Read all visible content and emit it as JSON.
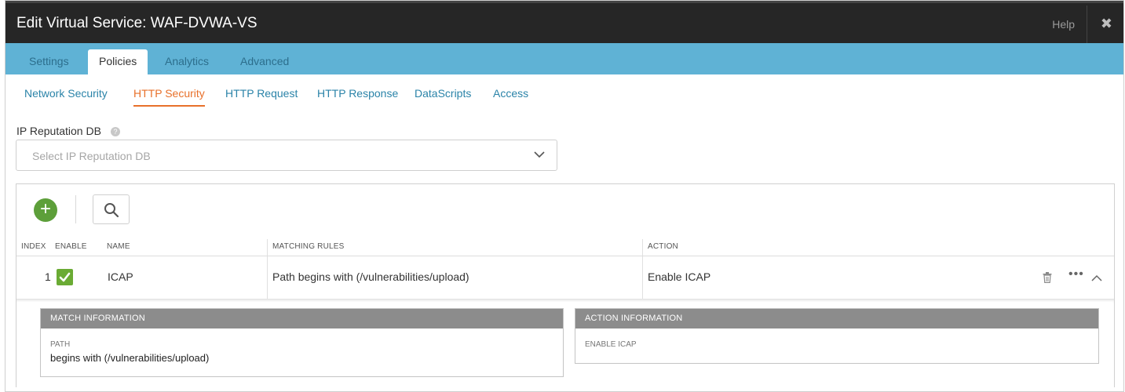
{
  "window": {
    "title": "Edit Virtual Service: WAF-DVWA-VS",
    "help_label": "Help",
    "close_glyph": "✖"
  },
  "tabs": [
    {
      "label": "Settings",
      "active": false
    },
    {
      "label": "Policies",
      "active": true
    },
    {
      "label": "Analytics",
      "active": false
    },
    {
      "label": "Advanced",
      "active": false
    }
  ],
  "subtabs": [
    {
      "label": "Network Security",
      "active": false
    },
    {
      "label": "HTTP Security",
      "active": true
    },
    {
      "label": "HTTP Request",
      "active": false
    },
    {
      "label": "HTTP Response",
      "active": false
    },
    {
      "label": "DataScripts",
      "active": false
    },
    {
      "label": "Access",
      "active": false
    }
  ],
  "ip_reputation": {
    "label": "IP Reputation DB",
    "help_icon": "?",
    "placeholder": "Select IP Reputation DB"
  },
  "toolbar": {
    "add_icon": "+"
  },
  "table": {
    "columns": [
      "INDEX",
      "ENABLE",
      "NAME",
      "MATCHING RULES",
      "ACTION"
    ],
    "rows": [
      {
        "index": "1",
        "enabled": true,
        "name": "ICAP",
        "matching_rules": "Path begins with (/vulnerabilities/upload)",
        "action": "Enable ICAP",
        "more_glyph": "•••"
      }
    ]
  },
  "detail": {
    "match": {
      "header": "MATCH INFORMATION",
      "label": "PATH",
      "value": "begins with (/vulnerabilities/upload)"
    },
    "action": {
      "header": "ACTION INFORMATION",
      "label": "ENABLE ICAP"
    }
  },
  "colors": {
    "tabbar": "#5fb2d5",
    "active_subtab": "#e8702a",
    "link": "#2a83a8",
    "add_button": "#5d9f3a",
    "checkbox": "#6aab34",
    "card_header": "#8c8c8c"
  }
}
